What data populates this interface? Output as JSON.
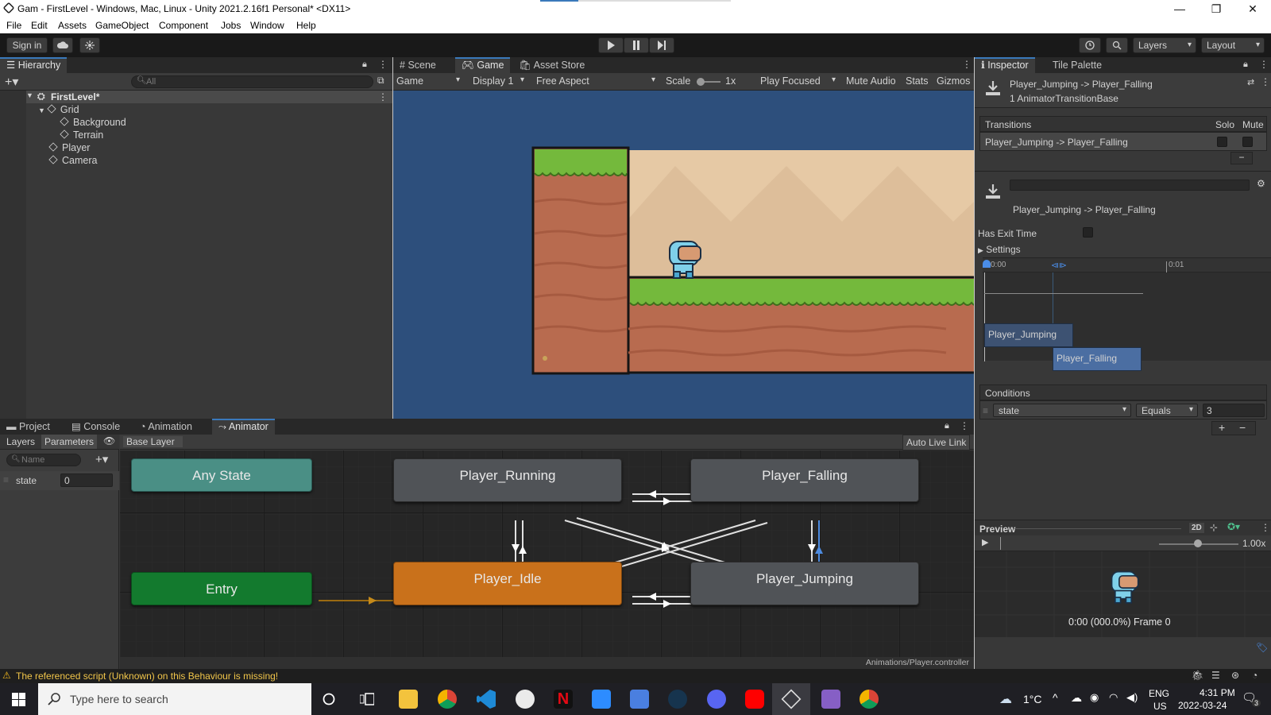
{
  "window": {
    "title": "Gam - FirstLevel - Windows, Mac, Linux - Unity 2021.2.16f1 Personal* <DX11>",
    "controls": [
      "—",
      "❐",
      "✕"
    ]
  },
  "menu": [
    "File",
    "Edit",
    "Assets",
    "GameObject",
    "Component",
    "Jobs",
    "Window",
    "Help"
  ],
  "toolbar": {
    "sign_in": "Sign in",
    "layers": "Layers",
    "layout": "Layout"
  },
  "hierarchy": {
    "tab": "Hierarchy",
    "search_placeholder": "All",
    "scene": "FirstLevel*",
    "items": [
      {
        "label": "Grid",
        "indent": 2
      },
      {
        "label": "Background",
        "indent": 3
      },
      {
        "label": "Terrain",
        "indent": 3
      },
      {
        "label": "Player",
        "indent": 2
      },
      {
        "label": "Camera",
        "indent": 2
      }
    ]
  },
  "game": {
    "tabs": [
      "Scene",
      "Game",
      "Asset Store"
    ],
    "game_dropdown": "Game",
    "display": "Display 1",
    "aspect": "Free Aspect",
    "scale_label": "Scale",
    "scale_value": "1x",
    "play_focused": "Play Focused",
    "mute_audio": "Mute Audio",
    "stats": "Stats",
    "gizmos": "Gizmos"
  },
  "bottom": {
    "tabs": [
      "Project",
      "Console",
      "Animation",
      "Animator"
    ],
    "layers": "Layers",
    "parameters": "Parameters",
    "breadcrumb": "Base Layer",
    "auto_live_link": "Auto Live Link",
    "name_placeholder": "Name",
    "param_name": "state",
    "param_value": "0",
    "footer_path": "Animations/Player.controller",
    "states": {
      "any": "Any State",
      "entry": "Entry",
      "running": "Player_Running",
      "falling": "Player_Falling",
      "idle": "Player_Idle",
      "jumping": "Player_Jumping"
    }
  },
  "inspector": {
    "tabs": [
      "Inspector",
      "Tile Palette"
    ],
    "header_title": "Player_Jumping -> Player_Falling",
    "header_sub": "1 AnimatorTransitionBase",
    "transitions_label": "Transitions",
    "solo": "Solo",
    "mute": "Mute",
    "transition_row": "Player_Jumping -> Player_Falling",
    "transition_name": "Player_Jumping -> Player_Falling",
    "has_exit_time": "Has Exit Time",
    "settings": "Settings",
    "t0": "0:00",
    "t1": "0:01",
    "clip_a": "Player_Jumping",
    "clip_b": "Player_Falling",
    "conditions": "Conditions",
    "cond_param": "state",
    "cond_op": "Equals",
    "cond_value": "3",
    "preview": "Preview",
    "preview_2d": "2D",
    "preview_speed": "1.00x",
    "preview_frame": "0:00 (000.0%) Frame 0"
  },
  "status": {
    "message": "The referenced script (Unknown) on this Behaviour is missing!"
  },
  "taskbar": {
    "search_placeholder": "Type here to search",
    "weather": "1°C",
    "lang1": "ENG",
    "lang2": "US",
    "time": "4:31 PM",
    "date": "2022-03-24",
    "notif_count": "3"
  }
}
